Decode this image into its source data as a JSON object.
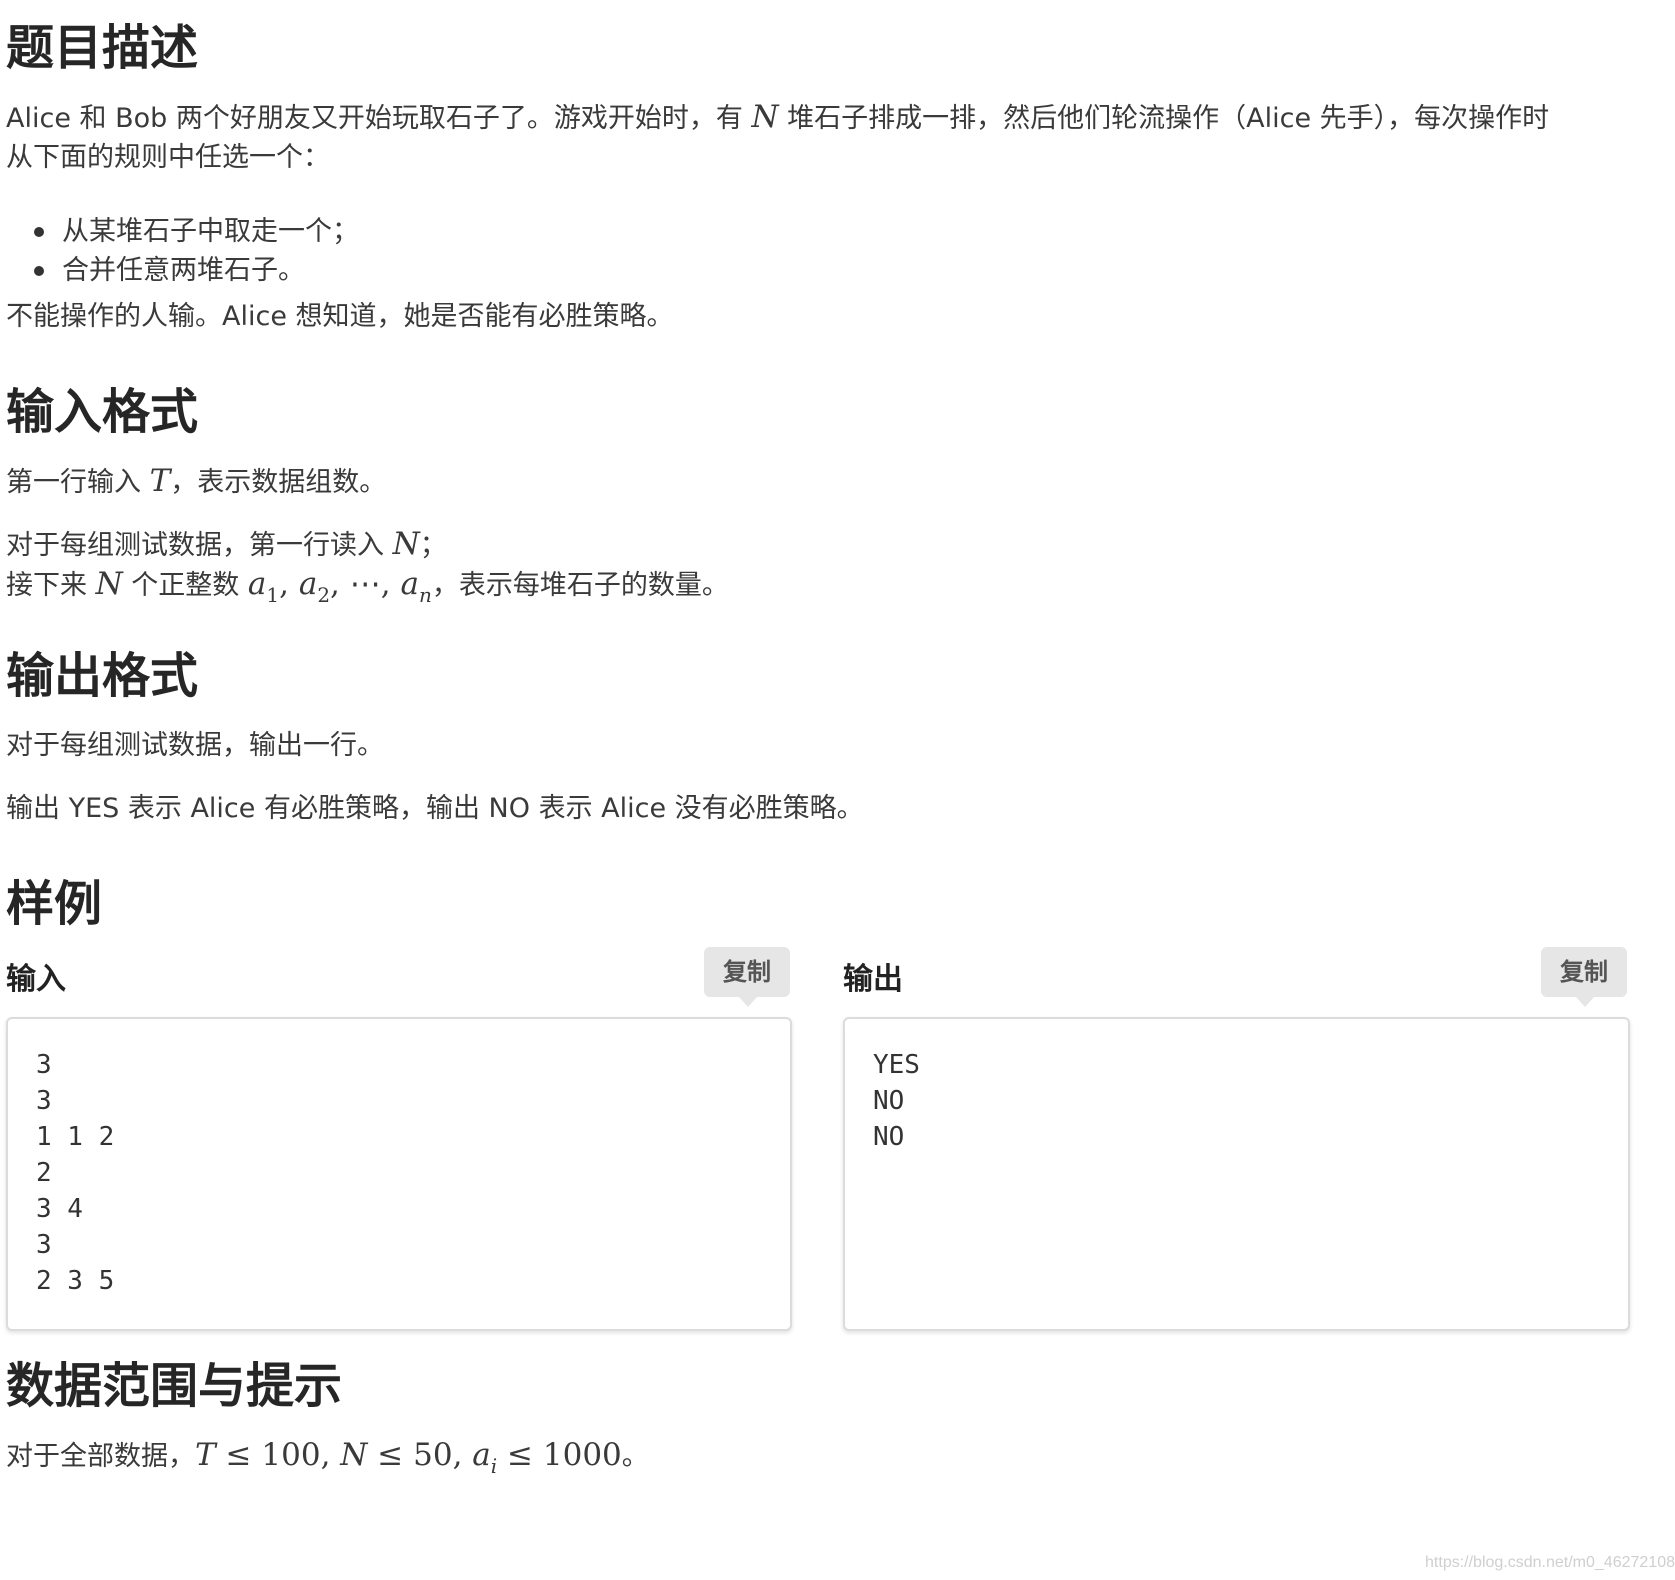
{
  "sections": {
    "description": {
      "title": "题目描述",
      "line1_a": "Alice 和 Bob 两个好朋友又开始玩取石子了。游戏开始时，有 ",
      "line1_math": "N",
      "line1_b": " 堆石子排成一排，然后他们轮流操作（Alice 先手），每次操作时",
      "line2": "从下面的规则中任选一个：",
      "rules": [
        "从某堆石子中取走一个；",
        "合并任意两堆石子。"
      ],
      "ending": "不能操作的人输。Alice 想知道，她是否能有必胜策略。"
    },
    "input_format": {
      "title": "输入格式",
      "p1_a": "第一行输入 ",
      "p1_math": "T",
      "p1_b": "，表示数据组数。",
      "p2_a": "对于每组测试数据，第一行读入 ",
      "p2_math": "N",
      "p2_b": "；",
      "p3_a": "接下来 ",
      "p3_math": "N",
      "p3_b": " 个正整数 ",
      "p3_seq_a": "a",
      "p3_sub1": "1",
      "p3_sub2": "2",
      "p3_dots": "⋯",
      "p3_subn": "n",
      "p3_c": "，表示每堆石子的数量。"
    },
    "output_format": {
      "title": "输出格式",
      "p1": "对于每组测试数据，输出一行。",
      "p2": "输出 YES 表示 Alice 有必胜策略，输出 NO 表示 Alice 没有必胜策略。"
    },
    "sample": {
      "title": "样例",
      "input_label": "输入",
      "output_label": "输出",
      "copy_label": "复制",
      "input_text": "3\n3\n1 1 2\n2\n3 4\n3\n2 3 5",
      "output_text": "YES\nNO\nNO"
    },
    "constraints": {
      "title": "数据范围与提示",
      "p_a": "对于全部数据，",
      "math_T": "T",
      "le": "≤",
      "v100": "100",
      "math_N": "N",
      "v50": "50",
      "math_a": "a",
      "sub_i": "i",
      "v1000": "1000",
      "p_end": "。"
    }
  },
  "watermark": "https://blog.csdn.net/m0_46272108"
}
